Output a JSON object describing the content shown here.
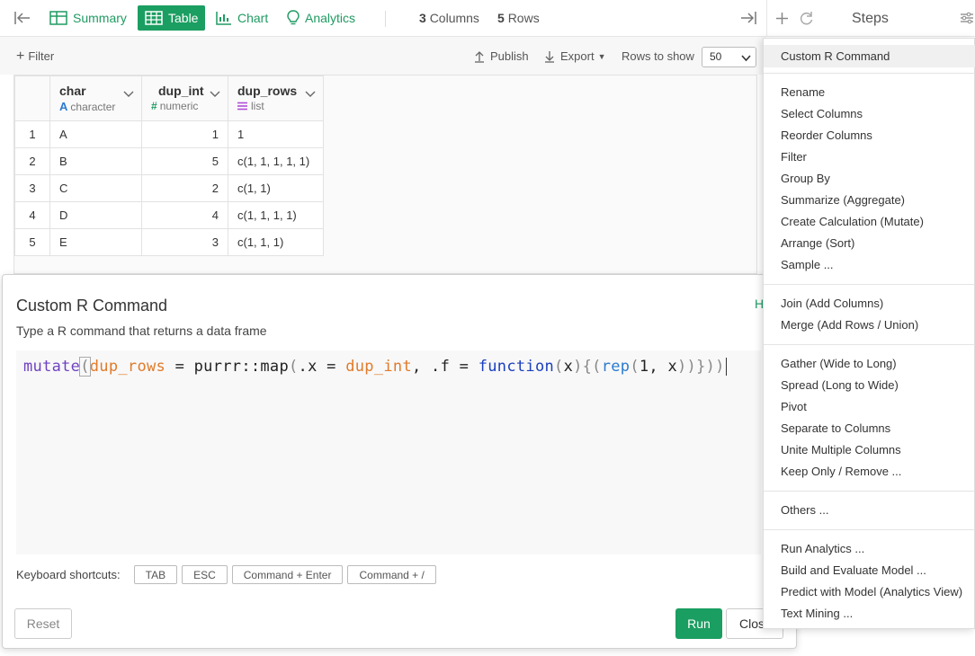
{
  "toolbar": {
    "summary": "Summary",
    "table": "Table",
    "chart": "Chart",
    "analytics": "Analytics",
    "columns_count": "3",
    "columns_label": "Columns",
    "rows_count": "5",
    "rows_label": "Rows"
  },
  "steps": {
    "title": "Steps"
  },
  "subbar": {
    "filter": "Filter",
    "publish": "Publish",
    "export": "Export",
    "rows_to_show_label": "Rows to show",
    "rows_to_show_value": "50"
  },
  "grid": {
    "columns": [
      {
        "name": "char",
        "type": "character",
        "type_icon": "A"
      },
      {
        "name": "dup_int",
        "type": "numeric",
        "type_icon": "#"
      },
      {
        "name": "dup_rows",
        "type": "list",
        "type_icon": "list-icon"
      }
    ],
    "rows": [
      {
        "n": "1",
        "char": "A",
        "dup_int": "1",
        "dup_rows": "1"
      },
      {
        "n": "2",
        "char": "B",
        "dup_int": "5",
        "dup_rows": "c(1, 1, 1, 1, 1)"
      },
      {
        "n": "3",
        "char": "C",
        "dup_int": "2",
        "dup_rows": "c(1, 1)"
      },
      {
        "n": "4",
        "char": "D",
        "dup_int": "4",
        "dup_rows": "c(1, 1, 1, 1)"
      },
      {
        "n": "5",
        "char": "E",
        "dup_int": "3",
        "dup_rows": "c(1, 1, 1)"
      }
    ]
  },
  "dialog": {
    "title": "Custom R Command",
    "help": "H",
    "subtitle": "Type a R command that returns a data frame",
    "code": {
      "t1": "mutate",
      "t2": "(",
      "t3": "dup_rows",
      "t4": " = purrr::map",
      "t5": "(",
      "t6": ".x = ",
      "t7": "dup_int",
      "t8": ", .f = ",
      "t9": "function",
      "t10": "(",
      "t11": "x",
      "t12": "){(",
      "t13": "rep",
      "t14": "(",
      "t15": "1, x",
      "t16": "))}))"
    },
    "shortcuts_label": "Keyboard shortcuts:",
    "shortcuts": [
      "TAB",
      "ESC",
      "Command + Enter",
      "Command + /"
    ],
    "reset": "Reset",
    "run": "Run",
    "close": "Close"
  },
  "menu": {
    "items": [
      "Custom R Command",
      "Rename",
      "Select Columns",
      "Reorder Columns",
      "Filter",
      "Group By",
      "Summarize (Aggregate)",
      "Create Calculation (Mutate)",
      "Arrange (Sort)",
      "Sample ...",
      "Join (Add Columns)",
      "Merge (Add Rows / Union)",
      "Gather (Wide to Long)",
      "Spread (Long to Wide)",
      "Pivot",
      "Separate to Columns",
      "Unite Multiple Columns",
      "Keep Only / Remove ...",
      "Others ...",
      "Run Analytics ...",
      "Build and Evaluate Model ...",
      "Predict with Model (Analytics View)",
      "Text Mining ..."
    ]
  },
  "colors": {
    "accent": "#1b9e61",
    "link": "#1f9b62"
  }
}
